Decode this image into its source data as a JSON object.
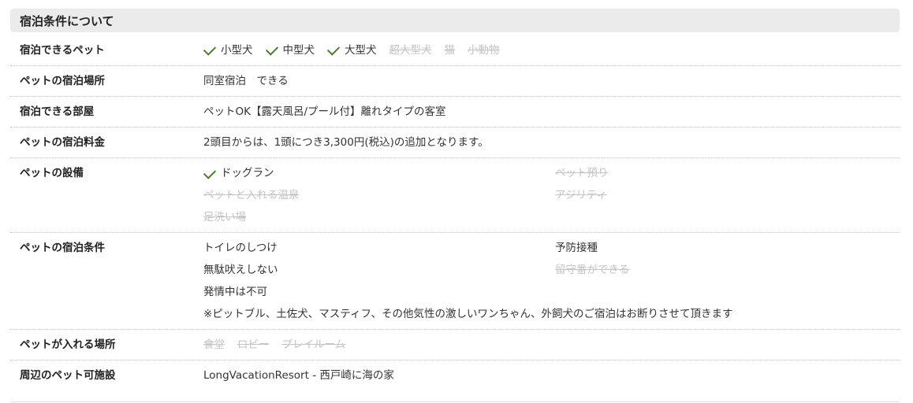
{
  "section": {
    "title": "宿泊条件について"
  },
  "rows": {
    "pets": {
      "label": "宿泊できるペット",
      "items": [
        {
          "text": "小型犬",
          "available": true
        },
        {
          "text": "中型犬",
          "available": true
        },
        {
          "text": "大型犬",
          "available": true
        },
        {
          "text": "超大型犬",
          "available": false
        },
        {
          "text": "猫",
          "available": false
        },
        {
          "text": "小動物",
          "available": false
        }
      ]
    },
    "location": {
      "label": "ペットの宿泊場所",
      "value": "同室宿泊　できる"
    },
    "rooms": {
      "label": "宿泊できる部屋",
      "value": "ペットOK【露天風呂/プール付】離れタイプの客室"
    },
    "fee": {
      "label": "ペットの宿泊料金",
      "value": "2頭目からは、1頭につき3,300円(税込)の追加となります。"
    },
    "facilities": {
      "label": "ペットの設備",
      "items": [
        {
          "text": "ドッグラン",
          "available": true
        },
        {
          "text": "ペット預り",
          "available": false
        },
        {
          "text": "ペットと入れる温泉",
          "available": false
        },
        {
          "text": "アジリティ",
          "available": false
        },
        {
          "text": "足洗い場",
          "available": false
        }
      ]
    },
    "conditions": {
      "label": "ペットの宿泊条件",
      "items": [
        {
          "text": "トイレのしつけ",
          "available": true
        },
        {
          "text": "予防接種",
          "available": true
        },
        {
          "text": "無駄吠えしない",
          "available": true
        },
        {
          "text": "留守番ができる",
          "available": false
        },
        {
          "text": "発情中は不可",
          "available": true
        }
      ],
      "note": "※ピットブル、土佐犬、マスティフ、その他気性の激しいワンちゃん、外飼犬のご宿泊はお断りさせて頂きます"
    },
    "areas": {
      "label": "ペットが入れる場所",
      "items": [
        {
          "text": "食堂",
          "available": false
        },
        {
          "text": "ロビー",
          "available": false
        },
        {
          "text": "プレイルーム",
          "available": false
        }
      ]
    },
    "nearby": {
      "label": "周辺のペット可施設",
      "value": "LongVacationResort ‐ 西戸崎に海の家"
    }
  },
  "colors": {
    "check": "#4e7a2f",
    "disabled": "#c4c4c4",
    "header_bg": "#ebebeb"
  }
}
